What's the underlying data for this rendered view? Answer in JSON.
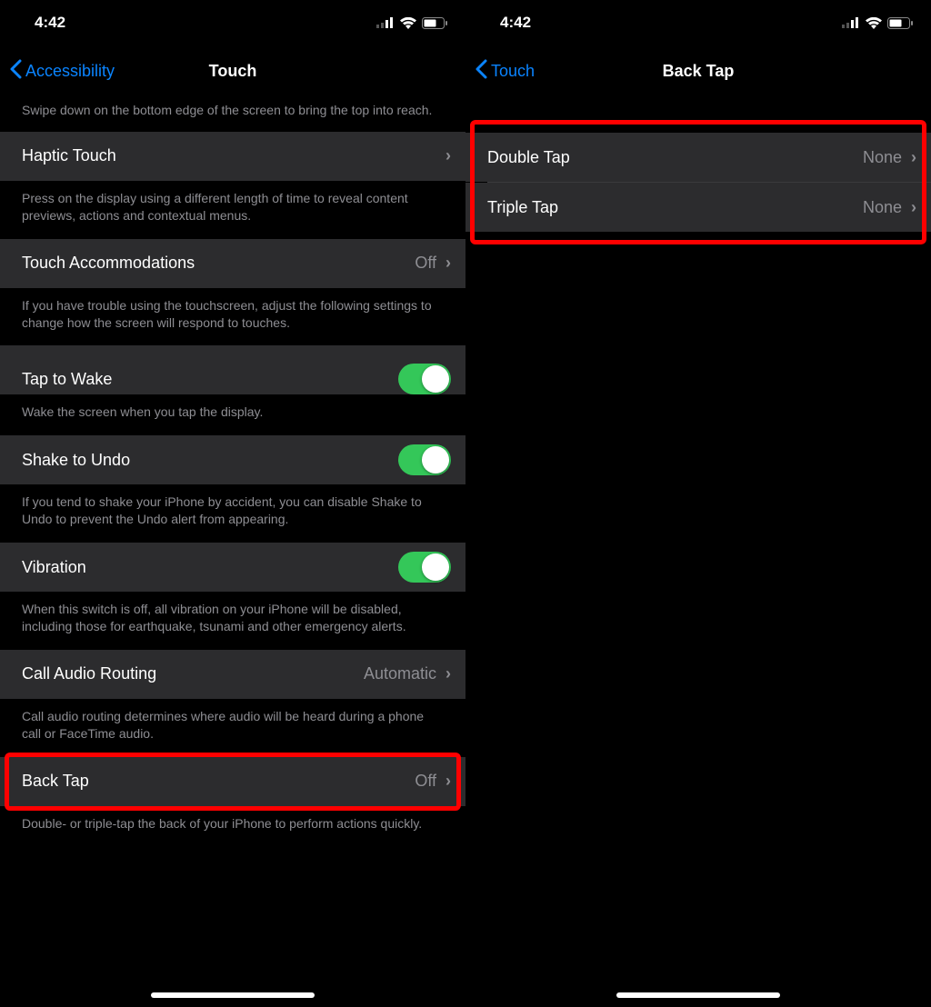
{
  "status_time": "4:42",
  "left": {
    "back_label": "Accessibility",
    "title": "Touch",
    "reachability_footer": "Swipe down on the bottom edge of the screen to bring the top into reach.",
    "haptic_touch": {
      "label": "Haptic Touch",
      "footer": "Press on the display using a different length of time to reveal content previews, actions and contextual menus."
    },
    "touch_accommodations": {
      "label": "Touch Accommodations",
      "value": "Off",
      "footer": "If you have trouble using the touchscreen, adjust the following settings to change how the screen will respond to touches."
    },
    "tap_to_wake": {
      "label": "Tap to Wake",
      "footer": "Wake the screen when you tap the display."
    },
    "shake_to_undo": {
      "label": "Shake to Undo",
      "footer": "If you tend to shake your iPhone by accident, you can disable Shake to Undo to prevent the Undo alert from appearing."
    },
    "vibration": {
      "label": "Vibration",
      "footer": "When this switch is off, all vibration on your iPhone will be disabled, including those for earthquake, tsunami and other emergency alerts."
    },
    "call_audio_routing": {
      "label": "Call Audio Routing",
      "value": "Automatic",
      "footer": "Call audio routing determines where audio will be heard during a phone call or FaceTime audio."
    },
    "back_tap": {
      "label": "Back Tap",
      "value": "Off",
      "footer": "Double- or triple-tap the back of your iPhone to perform actions quickly."
    }
  },
  "right": {
    "back_label": "Touch",
    "title": "Back Tap",
    "double_tap": {
      "label": "Double Tap",
      "value": "None"
    },
    "triple_tap": {
      "label": "Triple Tap",
      "value": "None"
    }
  }
}
